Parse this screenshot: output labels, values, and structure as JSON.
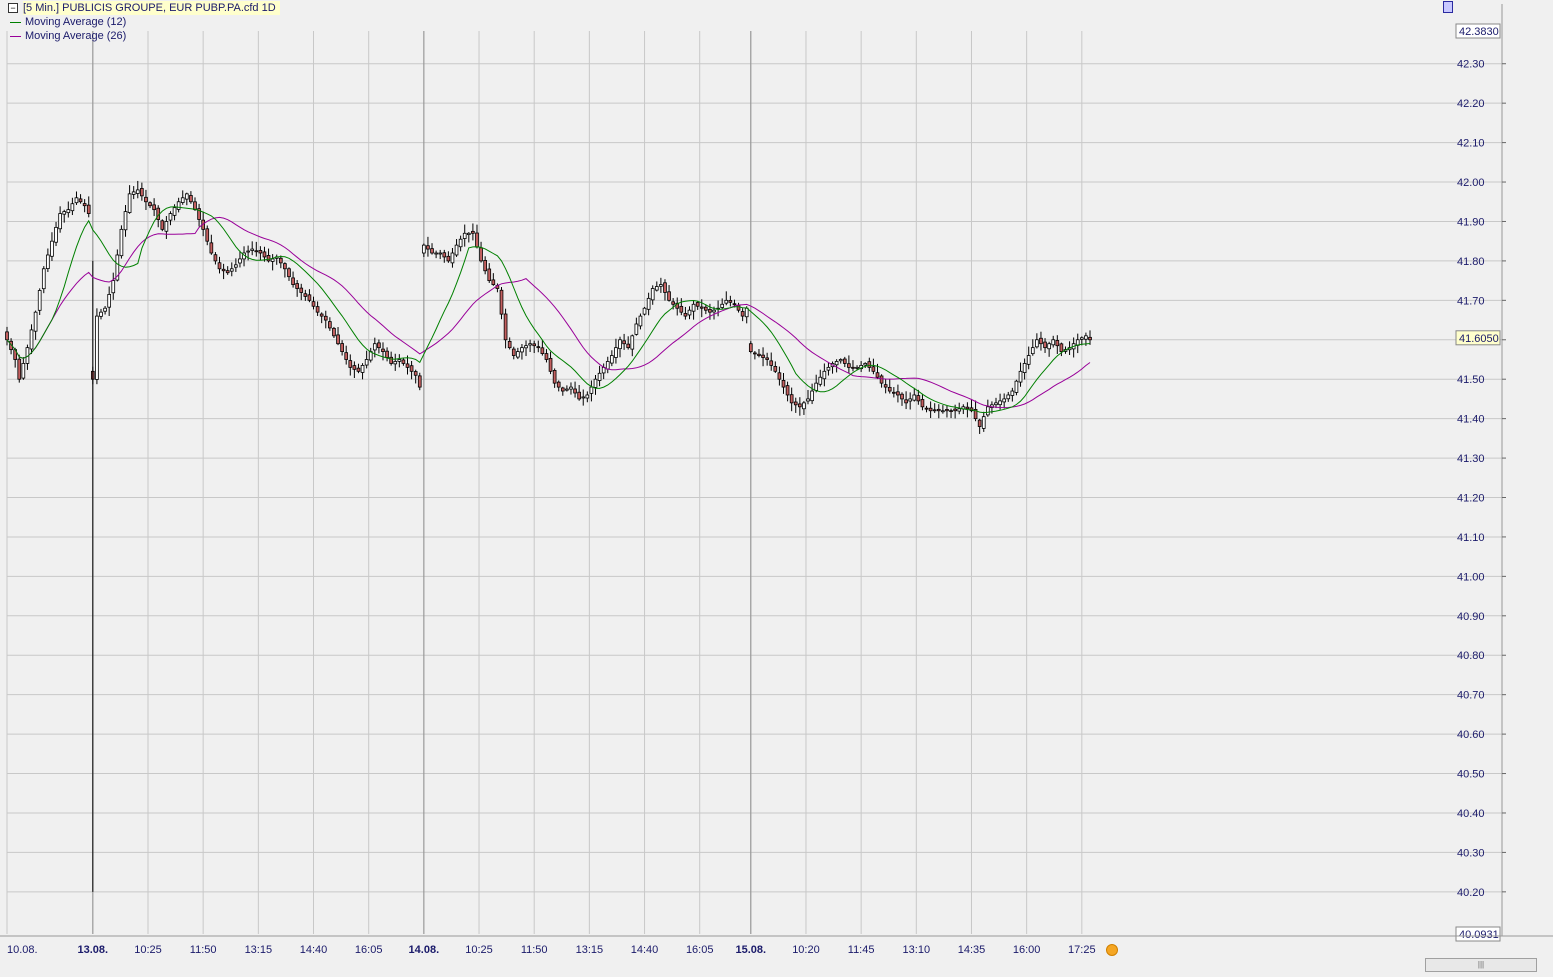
{
  "legend": {
    "title": "[5 Min.] PUBLICIS GROUPE, EUR   PUBP.PA.cfd 1D",
    "ma12_label": "Moving Average  (12)",
    "ma26_label": "Moving Average  (26)"
  },
  "colors": {
    "ma12": "#008000",
    "ma26": "#990099",
    "bull": "#ffffff",
    "bear": "#c46060",
    "grid": "#c8c8c8",
    "axis_text": "#1a1a6a"
  },
  "chart_data": {
    "type": "candlestick",
    "ylim": [
      40.0931,
      42.383
    ],
    "y_ticks": [
      "42.30",
      "42.20",
      "42.10",
      "42.00",
      "41.90",
      "41.80",
      "41.70",
      "41.60",
      "41.50",
      "41.40",
      "41.30",
      "41.20",
      "41.10",
      "41.00",
      "40.90",
      "40.80",
      "40.70",
      "40.60",
      "40.50",
      "40.40",
      "40.30",
      "40.20"
    ],
    "y_max_label": "42.3830",
    "y_min_label": "40.0931",
    "last_price": "41.6050",
    "x_ticks": [
      {
        "label": "10.08.",
        "bold": false
      },
      {
        "label": "13.08.",
        "bold": true
      },
      {
        "label": "10:25",
        "bold": false
      },
      {
        "label": "11:50",
        "bold": false
      },
      {
        "label": "13:15",
        "bold": false
      },
      {
        "label": "14:40",
        "bold": false
      },
      {
        "label": "16:05",
        "bold": false
      },
      {
        "label": "14.08.",
        "bold": true
      },
      {
        "label": "10:25",
        "bold": false
      },
      {
        "label": "11:50",
        "bold": false
      },
      {
        "label": "13:15",
        "bold": false
      },
      {
        "label": "14:40",
        "bold": false
      },
      {
        "label": "16:05",
        "bold": false
      },
      {
        "label": "15.08.",
        "bold": true
      },
      {
        "label": "10:20",
        "bold": false
      },
      {
        "label": "11:45",
        "bold": false
      },
      {
        "label": "13:10",
        "bold": false
      },
      {
        "label": "14:35",
        "bold": false
      },
      {
        "label": "16:00",
        "bold": false
      },
      {
        "label": "17:25",
        "bold": false
      }
    ],
    "close_path": [
      [
        0,
        41.6
      ],
      [
        2,
        41.55
      ],
      [
        3,
        41.5
      ],
      [
        5,
        41.58
      ],
      [
        7,
        41.67
      ],
      [
        9,
        41.78
      ],
      [
        11,
        41.85
      ],
      [
        13,
        41.92
      ],
      [
        15,
        41.93
      ],
      [
        17,
        41.96
      ],
      [
        19,
        41.94
      ],
      [
        20,
        41.92
      ],
      [
        21,
        41.5
      ],
      [
        22,
        41.66
      ],
      [
        24,
        41.68
      ],
      [
        26,
        41.75
      ],
      [
        28,
        41.88
      ],
      [
        30,
        41.97
      ],
      [
        32,
        41.98
      ],
      [
        34,
        41.95
      ],
      [
        36,
        41.93
      ],
      [
        38,
        41.88
      ],
      [
        40,
        41.92
      ],
      [
        42,
        41.95
      ],
      [
        44,
        41.97
      ],
      [
        46,
        41.93
      ],
      [
        48,
        41.88
      ],
      [
        50,
        41.82
      ],
      [
        52,
        41.78
      ],
      [
        54,
        41.77
      ],
      [
        56,
        41.79
      ],
      [
        58,
        41.82
      ],
      [
        60,
        41.83
      ],
      [
        62,
        41.82
      ],
      [
        64,
        41.8
      ],
      [
        66,
        41.81
      ],
      [
        68,
        41.78
      ],
      [
        70,
        41.74
      ],
      [
        72,
        41.72
      ],
      [
        74,
        41.7
      ],
      [
        76,
        41.67
      ],
      [
        78,
        41.65
      ],
      [
        80,
        41.61
      ],
      [
        82,
        41.57
      ],
      [
        84,
        41.53
      ],
      [
        86,
        41.52
      ],
      [
        88,
        41.55
      ],
      [
        90,
        41.59
      ],
      [
        92,
        41.57
      ],
      [
        94,
        41.54
      ],
      [
        96,
        41.55
      ],
      [
        98,
        41.53
      ],
      [
        100,
        41.51
      ],
      [
        101,
        41.48
      ],
      [
        102,
        41.84
      ],
      [
        104,
        41.82
      ],
      [
        106,
        41.82
      ],
      [
        108,
        41.8
      ],
      [
        110,
        41.84
      ],
      [
        112,
        41.87
      ],
      [
        114,
        41.87
      ],
      [
        116,
        41.8
      ],
      [
        118,
        41.75
      ],
      [
        120,
        41.73
      ],
      [
        122,
        41.6
      ],
      [
        124,
        41.56
      ],
      [
        126,
        41.58
      ],
      [
        128,
        41.59
      ],
      [
        130,
        41.58
      ],
      [
        132,
        41.55
      ],
      [
        134,
        41.49
      ],
      [
        136,
        41.47
      ],
      [
        138,
        41.48
      ],
      [
        140,
        41.45
      ],
      [
        142,
        41.46
      ],
      [
        144,
        41.5
      ],
      [
        146,
        41.53
      ],
      [
        148,
        41.56
      ],
      [
        150,
        41.6
      ],
      [
        152,
        41.58
      ],
      [
        154,
        41.64
      ],
      [
        156,
        41.68
      ],
      [
        158,
        41.73
      ],
      [
        160,
        41.74
      ],
      [
        162,
        41.7
      ],
      [
        164,
        41.68
      ],
      [
        166,
        41.66
      ],
      [
        168,
        41.69
      ],
      [
        170,
        41.68
      ],
      [
        172,
        41.67
      ],
      [
        174,
        41.68
      ],
      [
        176,
        41.7
      ],
      [
        178,
        41.69
      ],
      [
        180,
        41.66
      ],
      [
        181,
        41.68
      ],
      [
        182,
        41.57
      ],
      [
        184,
        41.56
      ],
      [
        186,
        41.55
      ],
      [
        188,
        41.52
      ],
      [
        190,
        41.48
      ],
      [
        192,
        41.44
      ],
      [
        194,
        41.43
      ],
      [
        196,
        41.45
      ],
      [
        198,
        41.49
      ],
      [
        200,
        41.52
      ],
      [
        202,
        41.54
      ],
      [
        204,
        41.55
      ],
      [
        206,
        41.53
      ],
      [
        208,
        41.53
      ],
      [
        210,
        41.54
      ],
      [
        212,
        41.52
      ],
      [
        214,
        41.49
      ],
      [
        216,
        41.47
      ],
      [
        218,
        41.46
      ],
      [
        220,
        41.44
      ],
      [
        222,
        41.46
      ],
      [
        224,
        41.43
      ],
      [
        226,
        41.42
      ],
      [
        228,
        41.42
      ],
      [
        230,
        41.42
      ],
      [
        232,
        41.42
      ],
      [
        234,
        41.43
      ],
      [
        236,
        41.42
      ],
      [
        238,
        41.38
      ],
      [
        240,
        41.43
      ],
      [
        242,
        41.44
      ],
      [
        244,
        41.45
      ],
      [
        246,
        41.47
      ],
      [
        248,
        41.52
      ],
      [
        250,
        41.56
      ],
      [
        252,
        41.6
      ],
      [
        254,
        41.58
      ],
      [
        256,
        41.6
      ],
      [
        258,
        41.57
      ],
      [
        260,
        41.58
      ],
      [
        262,
        41.6
      ],
      [
        264,
        41.61
      ],
      [
        265,
        41.6
      ]
    ],
    "day_separators": [
      21,
      102,
      182
    ],
    "x_tick_bars": [
      0,
      21,
      34.5,
      48,
      61.5,
      75,
      88.5,
      102,
      115.5,
      129,
      142.5,
      156,
      169.5,
      182,
      195.5,
      209,
      222.5,
      236,
      249.5,
      263
    ],
    "total_bars": 266
  }
}
